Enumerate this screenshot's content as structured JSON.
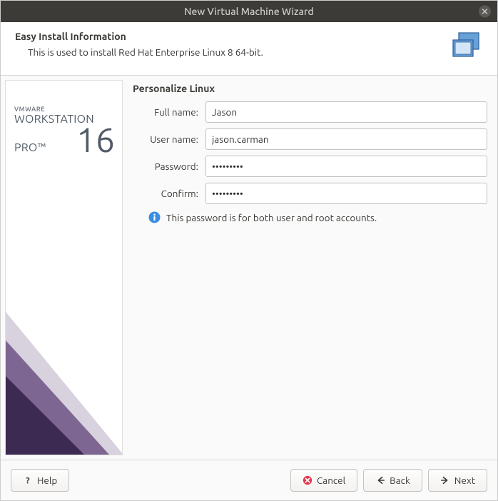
{
  "titlebar": {
    "title": "New Virtual Machine Wizard"
  },
  "header": {
    "title": "Easy Install Information",
    "description": "This is used to install Red Hat Enterprise Linux 8 64-bit."
  },
  "side": {
    "brand_small": "VMWARE",
    "brand_line1": "WORKSTATION",
    "brand_line2": "PRO™",
    "version": "16"
  },
  "form": {
    "section_title": "Personalize Linux",
    "fullname_label": "Full name:",
    "fullname_value": "Jason",
    "username_label": "User name:",
    "username_value": "jason.carman",
    "password_label": "Password:",
    "password_value": "•••••••••",
    "confirm_label": "Confirm:",
    "confirm_value": "•••••••••",
    "info_text": "This password is for both user and root accounts."
  },
  "buttons": {
    "help": "Help",
    "cancel": "Cancel",
    "back": "Back",
    "next": "Next"
  }
}
